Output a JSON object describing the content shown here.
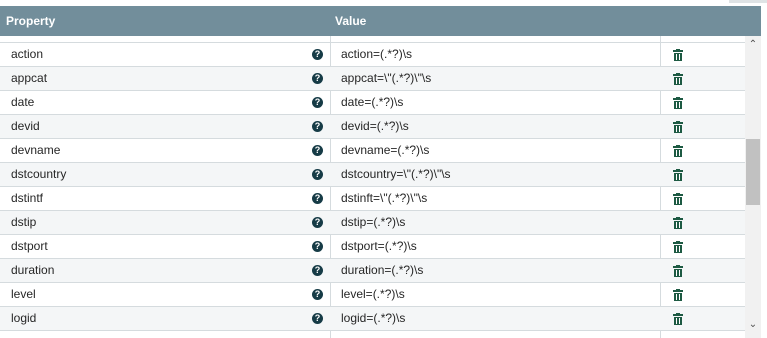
{
  "table": {
    "headers": {
      "property": "Property",
      "value": "Value"
    },
    "rows": [
      {
        "name": "action",
        "value": "action=(.*?)\\s"
      },
      {
        "name": "appcat",
        "value": "appcat=\\\"(.*?)\\\"\\s"
      },
      {
        "name": "date",
        "value": "date=(.*?)\\s"
      },
      {
        "name": "devid",
        "value": "devid=(.*?)\\s"
      },
      {
        "name": "devname",
        "value": "devname=(.*?)\\s"
      },
      {
        "name": "dstcountry",
        "value": "dstcountry=\\\"(.*?)\\\"\\s"
      },
      {
        "name": "dstintf",
        "value": "dstinft=\\\"(.*?)\\\"\\s"
      },
      {
        "name": "dstip",
        "value": "dstip=(.*?)\\s"
      },
      {
        "name": "dstport",
        "value": "dstport=(.*?)\\s"
      },
      {
        "name": "duration",
        "value": "duration=(.*?)\\s"
      },
      {
        "name": "level",
        "value": "level=(.*?)\\s"
      },
      {
        "name": "logid",
        "value": "logid=(.*?)\\s"
      }
    ],
    "help_glyph": "?",
    "row_icons": {
      "help": "help-circle-icon",
      "delete": "trash-icon"
    }
  },
  "scrollbar": {
    "up_glyph": "⌃",
    "down_glyph": "⌄",
    "position_fraction": 0.35
  },
  "colors": {
    "header_bg": "#728e9b",
    "header_text": "#ffffff",
    "row_alt_bg": "#f4f6f7",
    "grid_line": "#d5dbde",
    "help_icon": "#163b46",
    "trash_icon": "#1d5a43"
  }
}
